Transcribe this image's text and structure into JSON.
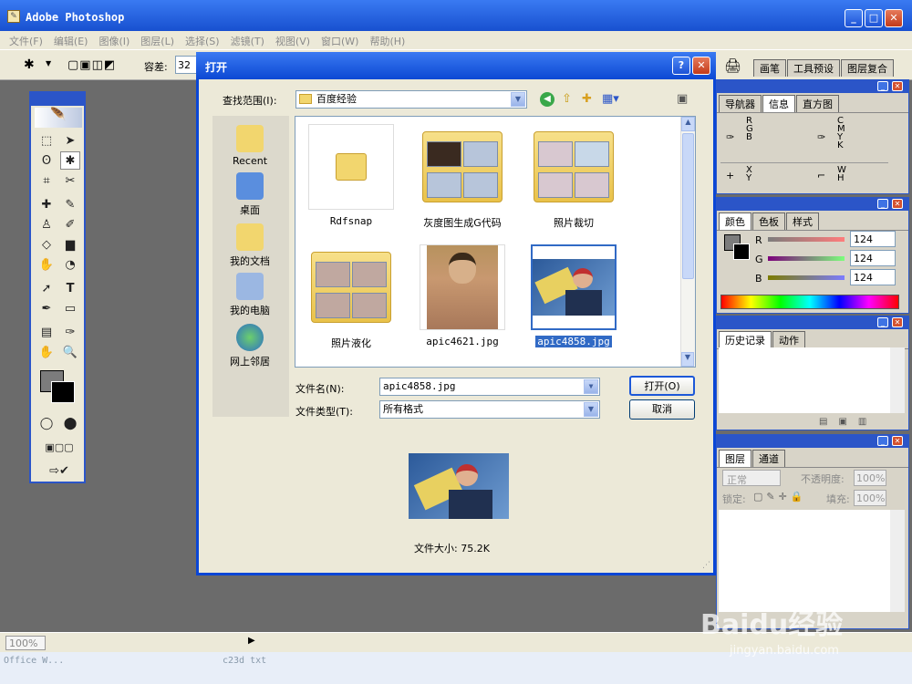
{
  "app": {
    "title": "Adobe Photoshop"
  },
  "menu": [
    "文件(F)",
    "编辑(E)",
    "图像(I)",
    "图层(L)",
    "选择(S)",
    "滤镜(T)",
    "视图(V)",
    "窗口(W)",
    "帮助(H)"
  ],
  "options": {
    "tolerance_label": "容差:",
    "tolerance_value": "32",
    "tabs": [
      "画笔",
      "工具预设",
      "图层复合"
    ]
  },
  "dialog": {
    "title": "打开",
    "lookin_label": "查找范围(I):",
    "lookin_value": "百度经验",
    "places": [
      "Recent",
      "桌面",
      "我的文档",
      "我的电脑",
      "网上邻居"
    ],
    "files": [
      {
        "name": "Rdfsnap",
        "kind": "folder-empty"
      },
      {
        "name": "灰度图生成G代码",
        "kind": "folder"
      },
      {
        "name": "照片裁切",
        "kind": "folder"
      },
      {
        "name": "照片液化",
        "kind": "folder"
      },
      {
        "name": "apic4621.jpg",
        "kind": "image"
      },
      {
        "name": "apic4858.jpg",
        "kind": "image",
        "selected": true
      }
    ],
    "filename_label": "文件名(N):",
    "filename_value": "apic4858.jpg",
    "filetype_label": "文件类型(T):",
    "filetype_value": "所有格式",
    "open_button": "打开(O)",
    "cancel_button": "取消",
    "filesize": "文件大小: 75.2K"
  },
  "panels": {
    "nav": {
      "tabs": [
        "导航器",
        "信息",
        "直方图"
      ],
      "rgb": [
        "R",
        "G",
        "B"
      ],
      "cmyk": [
        "C",
        "M",
        "Y",
        "K"
      ],
      "xy": [
        "X",
        "Y"
      ],
      "wh": [
        "W",
        "H"
      ]
    },
    "color": {
      "tabs": [
        "颜色",
        "色板",
        "样式"
      ],
      "sliders": [
        {
          "label": "R",
          "value": "124"
        },
        {
          "label": "G",
          "value": "124"
        },
        {
          "label": "B",
          "value": "124"
        }
      ]
    },
    "history": {
      "tabs": [
        "历史记录",
        "动作"
      ]
    },
    "layers": {
      "tabs": [
        "图层",
        "通道"
      ],
      "blend": "正常",
      "opacity_label": "不透明度:",
      "opacity_value": "100%",
      "lock_label": "锁定:",
      "fill_label": "填充:",
      "fill_value": "100%"
    }
  },
  "status": {
    "zoom": "100%"
  },
  "taskbar": {
    "left": "Office W...",
    "mid": "c23d txt"
  },
  "watermark": {
    "text": "Baidu经验",
    "url": "jingyan.baidu.com"
  },
  "colors": {
    "xp_blue": "#2b55c8",
    "chrome": "#ece9d8",
    "canvas": "#6b6b6b"
  }
}
